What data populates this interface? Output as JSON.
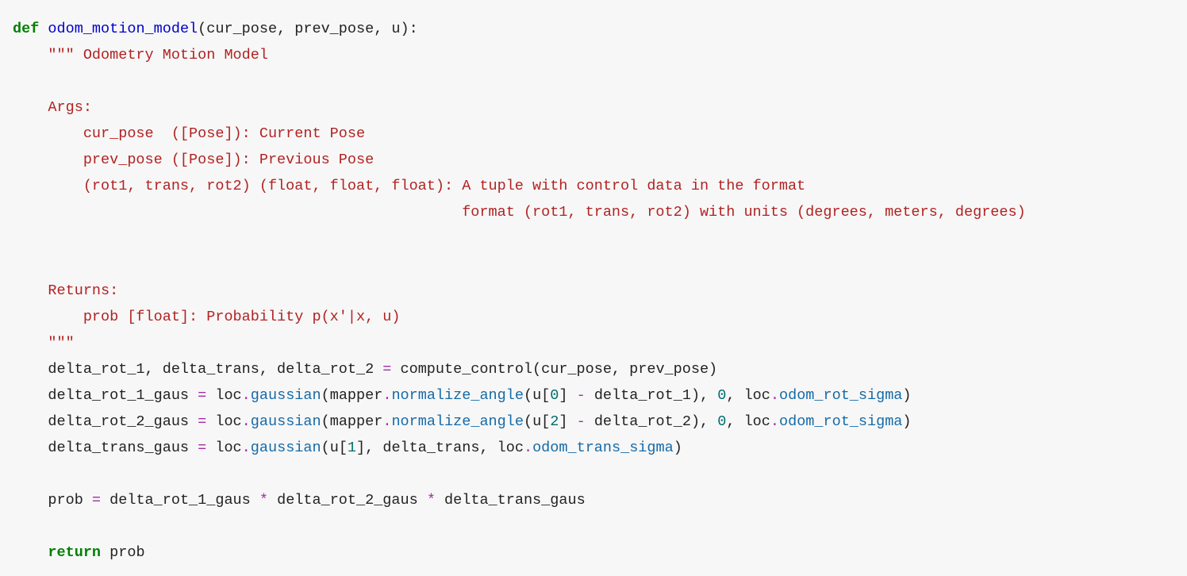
{
  "code": {
    "l01_def": "def",
    "l01_name": "odom_motion_model",
    "l01_params": "(cur_pose, prev_pose, u):",
    "doc1": "    \"\"\" Odometry Motion Model",
    "doc2": "",
    "doc3": "    Args:",
    "doc4": "        cur_pose  ([Pose]): Current Pose",
    "doc5": "        prev_pose ([Pose]): Previous Pose",
    "doc6": "        (rot1, trans, rot2) (float, float, float): A tuple with control data in the format",
    "doc7": "                                                   format (rot1, trans, rot2) with units (degrees, meters, degrees)",
    "doc8": "",
    "doc9": "",
    "doc10": "    Returns:",
    "doc11": "        prob [float]: Probability p(x'|x, u)",
    "doc12": "    \"\"\"",
    "s1_a": "    delta_rot_1, delta_trans, delta_rot_2 ",
    "s1_eq": "=",
    "s1_b": " compute_control(cur_pose, prev_pose)",
    "s2_a": "    delta_rot_1_gaus ",
    "s2_eq": "=",
    "s2_b": " loc",
    "s2_dot1": ".",
    "s2_gauss": "gaussian",
    "s2_c": "(mapper",
    "s2_dot2": ".",
    "s2_norm": "normalize_angle",
    "s2_d": "(u[",
    "s2_idx": "0",
    "s2_e": "] ",
    "s2_minus": "-",
    "s2_f": " delta_rot_1), ",
    "s2_zero": "0",
    "s2_g": ", loc",
    "s2_dot3": ".",
    "s2_sig": "odom_rot_sigma",
    "s2_h": ")",
    "s3_a": "    delta_rot_2_gaus ",
    "s3_eq": "=",
    "s3_b": " loc",
    "s3_dot1": ".",
    "s3_gauss": "gaussian",
    "s3_c": "(mapper",
    "s3_dot2": ".",
    "s3_norm": "normalize_angle",
    "s3_d": "(u[",
    "s3_idx": "2",
    "s3_e": "] ",
    "s3_minus": "-",
    "s3_f": " delta_rot_2), ",
    "s3_zero": "0",
    "s3_g": ", loc",
    "s3_dot3": ".",
    "s3_sig": "odom_rot_sigma",
    "s3_h": ")",
    "s4_a": "    delta_trans_gaus ",
    "s4_eq": "=",
    "s4_b": " loc",
    "s4_dot1": ".",
    "s4_gauss": "gaussian",
    "s4_c": "(u[",
    "s4_idx": "1",
    "s4_d": "], delta_trans, loc",
    "s4_dot2": ".",
    "s4_sig": "odom_trans_sigma",
    "s4_e": ")",
    "blank1": "",
    "s5_a": "    prob ",
    "s5_eq": "=",
    "s5_b": " delta_rot_1_gaus ",
    "s5_m1": "*",
    "s5_c": " delta_rot_2_gaus ",
    "s5_m2": "*",
    "s5_d": " delta_trans_gaus",
    "blank2": "",
    "ret_indent": "    ",
    "ret_kw": "return",
    "ret_val": " prob"
  }
}
